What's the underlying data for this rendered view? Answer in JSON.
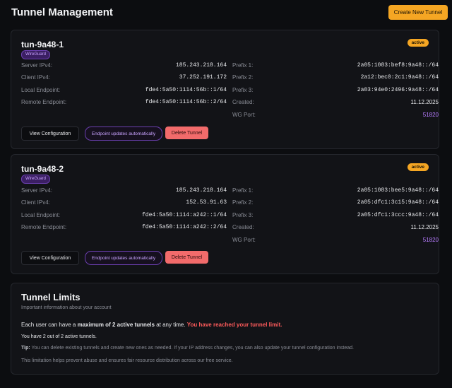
{
  "header": {
    "title": "Tunnel Management",
    "create_label": "Create New Tunnel"
  },
  "labels": {
    "server_ipv4": "Server IPv4:",
    "client_ipv4": "Client IPv4:",
    "local_endpoint": "Local Endpoint:",
    "remote_endpoint": "Remote Endpoint:",
    "prefix1": "Prefix 1:",
    "prefix2": "Prefix 2:",
    "prefix3": "Prefix 3:",
    "created": "Created:",
    "wg_port": "WG Port:"
  },
  "tunnels": [
    {
      "name": "tun-9a48-1",
      "protocol": "WireGuard",
      "status": "active",
      "server_ipv4": "185.243.218.164",
      "client_ipv4": "37.252.191.172",
      "local_endpoint": "fde4:5a50:1114:56b::1/64",
      "remote_endpoint": "fde4:5a50:1114:56b::2/64",
      "prefix1": "2a05:1083:bef8:9a48::/64",
      "prefix2": "2a12:bec0:2c1:9a48::/64",
      "prefix3": "2a03:94e0:2496:9a48::/64",
      "created": "11.12.2025",
      "wg_port": "51820",
      "view_label": "View Configuration",
      "auto_label": "Endpoint updates automatically",
      "delete_label": "Delete Tunnel"
    },
    {
      "name": "tun-9a48-2",
      "protocol": "WireGuard",
      "status": "active",
      "server_ipv4": "185.243.218.164",
      "client_ipv4": "152.53.91.63",
      "local_endpoint": "fde4:5a50:1114:a242::1/64",
      "remote_endpoint": "fde4:5a50:1114:a242::2/64",
      "prefix1": "2a05:1083:bee5:9a48::/64",
      "prefix2": "2a05:dfc1:3c15:9a48::/64",
      "prefix3": "2a05:dfc1:3ccc:9a48::/64",
      "created": "11.12.2025",
      "wg_port": "51820",
      "view_label": "View Configuration",
      "auto_label": "Endpoint updates automatically",
      "delete_label": "Delete Tunnel"
    }
  ],
  "limits": {
    "title": "Tunnel Limits",
    "subtitle": "Important information about your account",
    "line_pre": "Each user can have a ",
    "line_bold": "maximum of 2 active tunnels",
    "line_post": " at any time. ",
    "line_warn": "You have reached your tunnel limit.",
    "count_text": "You have 2 out of 2 active tunnels.",
    "tip_label": "Tip:",
    "tip_text": " You can delete existing tunnels and create new ones as needed. If your IP address changes, you can also update your tunnel configuration instead.",
    "note": "This limitation helps prevent abuse and ensures fair resource distribution across our free service."
  }
}
